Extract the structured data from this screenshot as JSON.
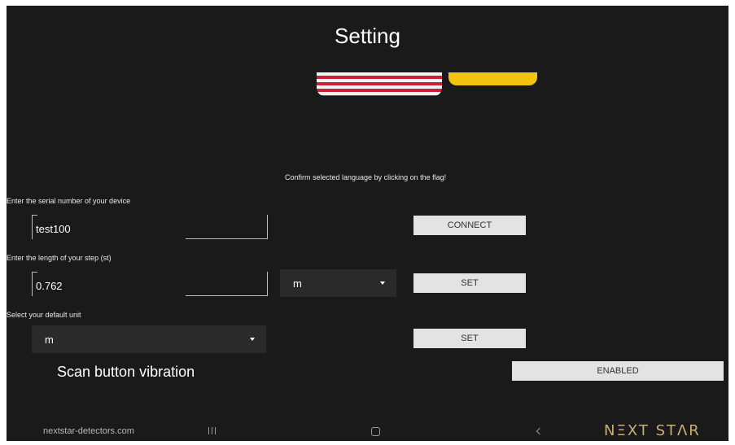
{
  "header": {
    "title": "Setting"
  },
  "language": {
    "flags": [
      {
        "name": "us-flag"
      },
      {
        "name": "yellow-flag",
        "color": "#f1c40f"
      }
    ],
    "hint": "Confirm selected language by clicking on the flag!"
  },
  "serial": {
    "label": "Enter the serial number of your device",
    "value": "test100",
    "button": "CONNECT"
  },
  "step": {
    "label": "Enter the length of your step (st)",
    "value": "0.762",
    "unit": "m",
    "button": "SET"
  },
  "default_unit": {
    "label": "Select your default unit",
    "value": "m",
    "button": "SET"
  },
  "vibration": {
    "label": "Scan button vibration",
    "button": "ENABLED"
  },
  "footer": {
    "site": "nextstar-detectors.com",
    "brand": "NΞXT STΛR",
    "brand_color": "#c9b07a"
  },
  "colors": {
    "background": "#1a1a1a",
    "button_bg": "#e3e3e3",
    "select_bg": "#2a2a2a"
  }
}
